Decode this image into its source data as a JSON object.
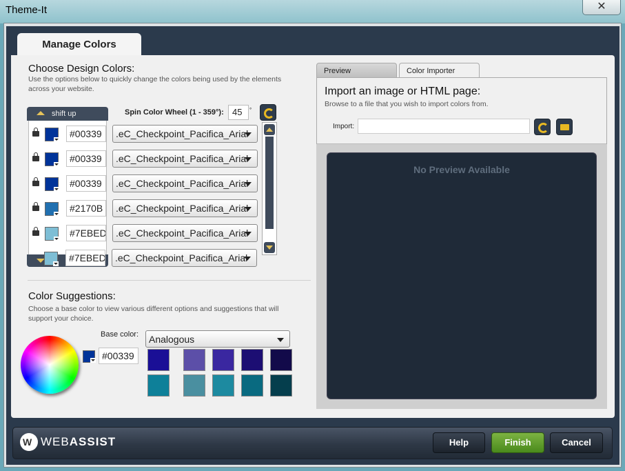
{
  "window": {
    "title": "Theme-It",
    "close_glyph": "✕"
  },
  "main_tab": {
    "label": "Manage Colors"
  },
  "design": {
    "title": "Choose Design Colors:",
    "desc_line1": "Use the options below to quickly change the colors being used by the elements",
    "desc_line2": "across your website.",
    "shift_up_label": "shift up",
    "spin_label": "Spin Color Wheel (1 - 359°):",
    "spin_value": "45",
    "spin_unit": "°",
    "rows": [
      {
        "color": "#003399",
        "hex": "#00339",
        "element": ".eC_Checkpoint_Pacifica_Arial"
      },
      {
        "color": "#003399",
        "hex": "#00339",
        "element": ".eC_Checkpoint_Pacifica_Arial"
      },
      {
        "color": "#003399",
        "hex": "#00339",
        "element": ".eC_Checkpoint_Pacifica_Arial"
      },
      {
        "color": "#2170B0",
        "hex": "#2170B",
        "element": ".eC_Checkpoint_Pacifica_Arial"
      },
      {
        "color": "#7EBED5",
        "hex": "#7EBED",
        "element": ".eC_Checkpoint_Pacifica_Arial"
      },
      {
        "color": "#7EBED5",
        "hex": "#7EBED",
        "element": ".eC_Checkpoint_Pacifica_Arial"
      }
    ]
  },
  "suggestions": {
    "title": "Color Suggestions:",
    "desc_line1": "Choose a base color to view various different options and suggestions that will",
    "desc_line2": "support your choice.",
    "base_color_label": "Base color:",
    "scheme": "Analogous",
    "base_color": "#003399",
    "base_hex": "#00339",
    "tiles_top": [
      "#1A0F96",
      "#5C4FA8",
      "#3A27A0",
      "#1C0E73",
      "#120A4A"
    ],
    "tiles_bottom": [
      "#0E8099",
      "#4A8FA0",
      "#1D8AA0",
      "#096A80",
      "#053E4D"
    ]
  },
  "right": {
    "tab_preview": "Preview",
    "tab_importer": "Color Importer",
    "import_title": "Import an image or HTML page:",
    "import_desc": "Browse to a file that you wish to import colors from.",
    "import_label": "Import:",
    "no_preview": "No Preview Available"
  },
  "footer": {
    "logo_web": "WEB",
    "logo_assist": "ASSIST",
    "help": "Help",
    "finish": "Finish",
    "cancel": "Cancel"
  }
}
